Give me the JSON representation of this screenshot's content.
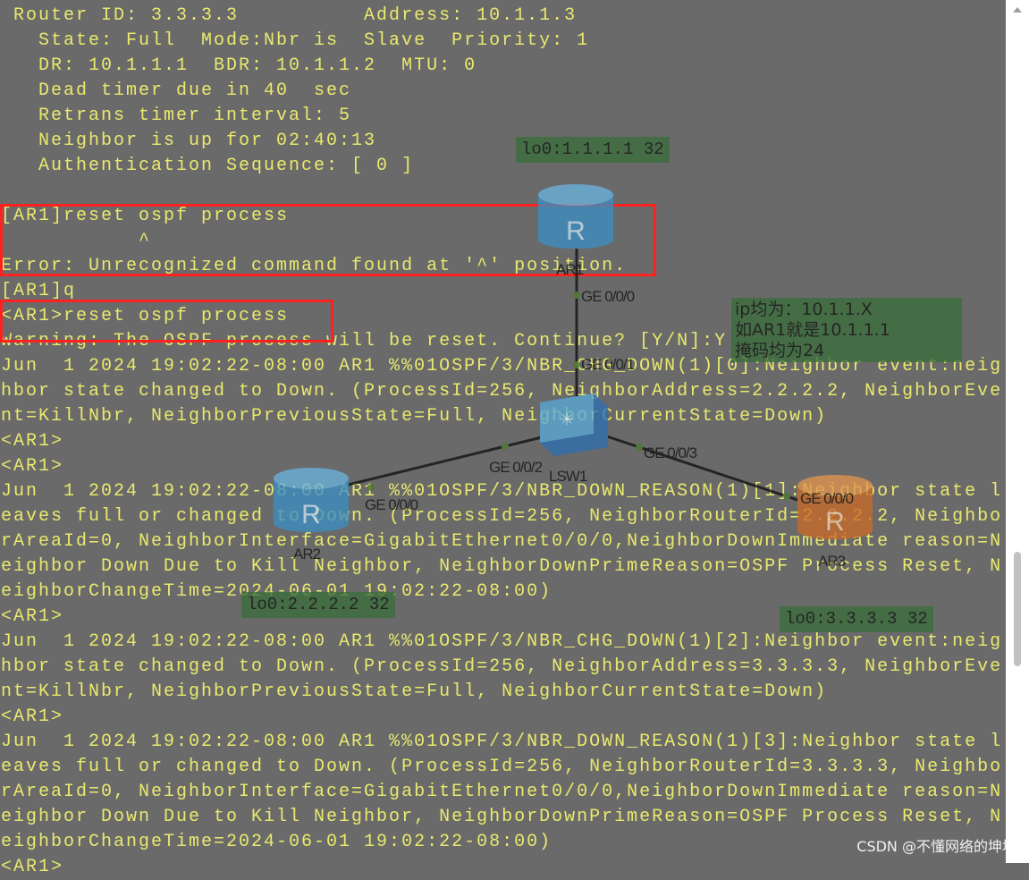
{
  "terminal": {
    "lines": [
      " Router ID: 3.3.3.3          Address: 10.1.1.3",
      "   State: Full  Mode:Nbr is  Slave  Priority: 1",
      "   DR: 10.1.1.1  BDR: 10.1.1.2  MTU: 0",
      "   Dead timer due in 40  sec",
      "   Retrans timer interval: 5",
      "   Neighbor is up for 02:40:13",
      "   Authentication Sequence: [ 0 ]",
      "",
      "[AR1]reset ospf process",
      "           ^",
      "Error: Unrecognized command found at '^' position.",
      "[AR1]q",
      "<AR1>reset ospf process",
      "Warning: The OSPF process will be reset. Continue? [Y/N]:Y",
      "Jun  1 2024 19:02:22-08:00 AR1 %%01OSPF/3/NBR_CHG_DOWN(1)[0]:Neighbor event:neig",
      "hbor state changed to Down. (ProcessId=256, NeighborAddress=2.2.2.2, NeighborEve",
      "nt=KillNbr, NeighborPreviousState=Full, NeighborCurrentState=Down)",
      "<AR1>",
      "<AR1>",
      "Jun  1 2024 19:02:22-08:00 AR1 %%01OSPF/3/NBR_DOWN_REASON(1)[1]:Neighbor state l",
      "eaves full or changed to Down. (ProcessId=256, NeighborRouterId=2.2.2.2, Neighbo",
      "rAreaId=0, NeighborInterface=GigabitEthernet0/0/0,NeighborDownImmediate reason=N",
      "eighbor Down Due to Kill Neighbor, NeighborDownPrimeReason=OSPF Process Reset, N",
      "eighborChangeTime=2024-06-01 19:02:22-08:00)",
      "<AR1>",
      "Jun  1 2024 19:02:22-08:00 AR1 %%01OSPF/3/NBR_CHG_DOWN(1)[2]:Neighbor event:neig",
      "hbor state changed to Down. (ProcessId=256, NeighborAddress=3.3.3.3, NeighborEve",
      "nt=KillNbr, NeighborPreviousState=Full, NeighborCurrentState=Down)",
      "<AR1>",
      "Jun  1 2024 19:02:22-08:00 AR1 %%01OSPF/3/NBR_DOWN_REASON(1)[3]:Neighbor state l",
      "eaves full or changed to Down. (ProcessId=256, NeighborRouterId=3.3.3.3, Neighbo",
      "rAreaId=0, NeighborInterface=GigabitEthernet0/0/0,NeighborDownImmediate reason=N",
      "eighbor Down Due to Kill Neighbor, NeighborDownPrimeReason=OSPF Process Reset, N",
      "eighborChangeTime=2024-06-01 19:02:22-08:00)",
      "<AR1>"
    ]
  },
  "colors": {
    "background": "#6a6a6a",
    "text": "#e9e96e",
    "highlight": "#ff2020",
    "label_box": "#3b6e3b"
  },
  "diagram": {
    "devices": {
      "ar1": "AR1",
      "ar2": "AR2",
      "ar3": "AR3",
      "lsw1": "LSW1"
    },
    "ports": {
      "ar1_ge0": "GE 0/0/0",
      "lsw1_ge1": "GE 0/0/1",
      "lsw1_ge2": "GE 0/0/2",
      "lsw1_ge3": "GE 0/0/3",
      "ar2_ge0": "GE 0/0/0",
      "ar3_ge0": "GE 0/0/0"
    },
    "loopbacks": {
      "ar1": "lo0:1.1.1.1 32",
      "ar2": "lo0:2.2.2.2 32",
      "ar3": "lo0:3.3.3.3 32"
    },
    "note": [
      "ip均为：10.1.1.X",
      "如AR1就是10.1.1.1",
      "掩码均为24"
    ]
  },
  "watermark": "CSDN @不懂网络的坤坤"
}
